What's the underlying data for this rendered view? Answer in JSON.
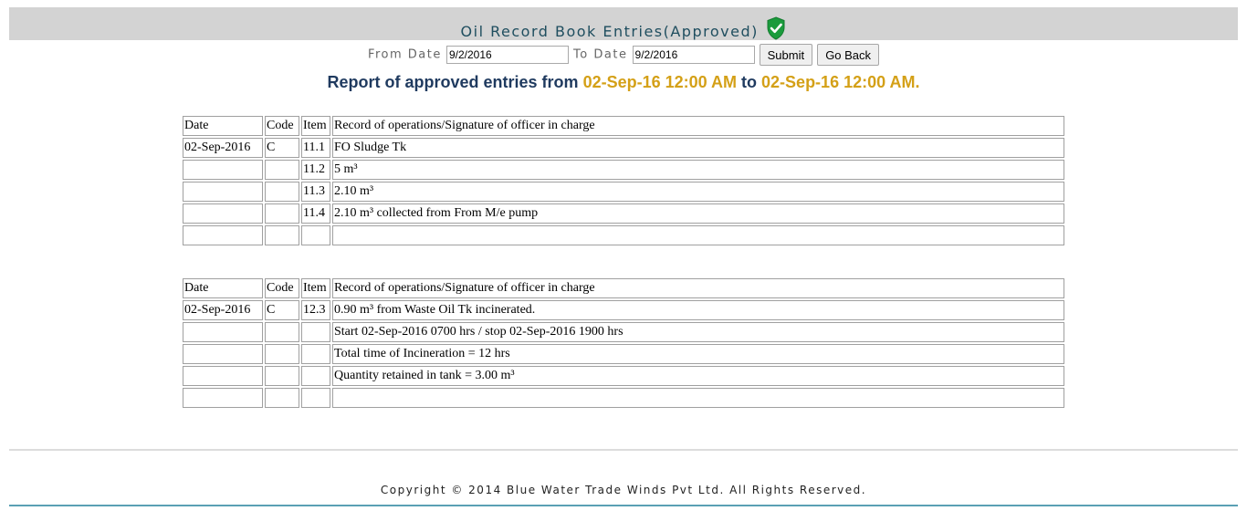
{
  "header": {
    "title": "Oil Record Book Entries(Approved)",
    "icon": "shield-check-icon",
    "icon_color": "#1a9b3c"
  },
  "filters": {
    "from_label": "From Date",
    "from_value": "9/2/2016",
    "to_label": "To Date",
    "to_value": "9/2/2016",
    "submit_label": "Submit",
    "back_label": "Go Back"
  },
  "report": {
    "prefix": "Report of approved entries from",
    "from": "02-Sep-16 12:00 AM",
    "middle": "to",
    "to": "02-Sep-16 12:00 AM",
    "suffix": "."
  },
  "tables": [
    {
      "headers": [
        "Date",
        "Code",
        "Item",
        "Record of operations/Signature of officer in charge"
      ],
      "rows": [
        [
          "02-Sep-2016",
          "C",
          "11.1",
          "FO Sludge Tk"
        ],
        [
          "",
          "",
          "11.2",
          "5 m³"
        ],
        [
          "",
          "",
          "11.3",
          "2.10 m³"
        ],
        [
          "",
          "",
          "11.4",
          "2.10 m³ collected from From M/e pump"
        ],
        [
          "",
          "",
          "",
          ""
        ]
      ]
    },
    {
      "headers": [
        "Date",
        "Code",
        "Item",
        "Record of operations/Signature of officer in charge"
      ],
      "rows": [
        [
          "02-Sep-2016",
          "C",
          "12.3",
          "0.90 m³ from Waste Oil Tk incinerated."
        ],
        [
          "",
          "",
          "",
          "Start 02-Sep-2016 0700 hrs / stop 02-Sep-2016 1900 hrs"
        ],
        [
          "",
          "",
          "",
          "Total time of Incineration = 12 hrs"
        ],
        [
          "",
          "",
          "",
          "Quantity retained in tank = 3.00 m³"
        ],
        [
          "",
          "",
          "",
          ""
        ]
      ]
    }
  ],
  "footer": {
    "copyright": "Copyright © 2014 Blue Water Trade Winds Pvt Ltd. All Rights Reserved."
  }
}
